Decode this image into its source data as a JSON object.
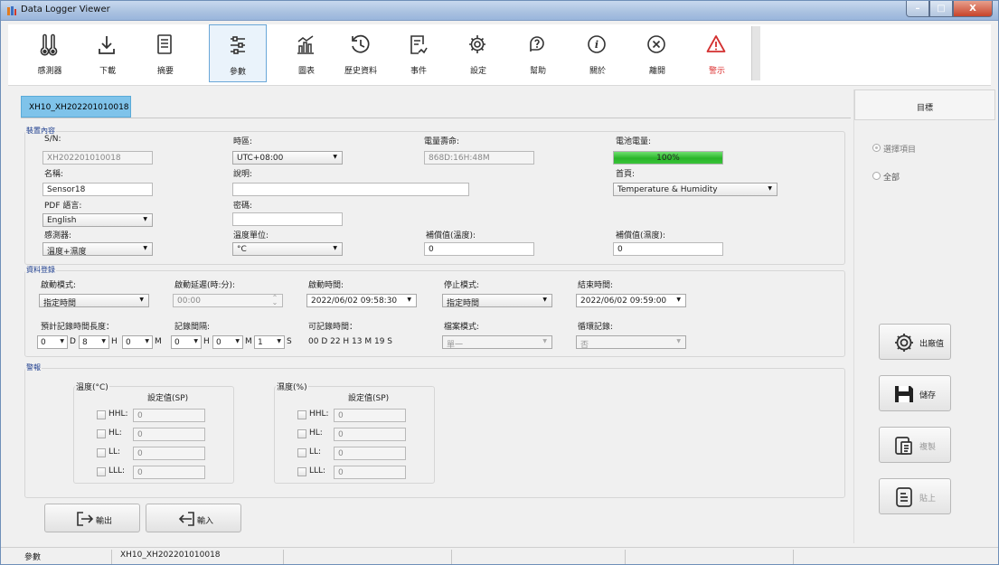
{
  "window": {
    "title": "Data Logger Viewer",
    "controls": {
      "minimize": "–",
      "maximize": "□",
      "close": "X"
    }
  },
  "toolbar": {
    "items": [
      {
        "label": "感測器",
        "icon": "thermometers-icon"
      },
      {
        "label": "下載",
        "icon": "download-icon"
      },
      {
        "label": "摘要",
        "icon": "summary-icon"
      },
      {
        "label": "參數",
        "icon": "sliders-icon",
        "selected": true
      },
      {
        "label": "圖表",
        "icon": "chart-icon"
      },
      {
        "label": "歷史資料",
        "icon": "history-icon"
      },
      {
        "label": "事件",
        "icon": "event-icon"
      },
      {
        "label": "設定",
        "icon": "gear-icon"
      },
      {
        "label": "幫助",
        "icon": "help-icon"
      },
      {
        "label": "關於",
        "icon": "info-icon"
      },
      {
        "label": "離開",
        "icon": "close-circle-icon"
      },
      {
        "label": "警示",
        "icon": "warning-icon",
        "color": "#d32f2f"
      }
    ]
  },
  "device_tab": {
    "label": "XH10_XH202201010018"
  },
  "device_info": {
    "group_title": "裝置內容",
    "sn_label": "S/N:",
    "sn_value": "XH202201010018",
    "timezone_label": "時區:",
    "timezone_value": "UTC+08:00",
    "battery_life_label": "電量壽命:",
    "battery_life_value": "868D:16H:48M",
    "battery_level_label": "電池電量:",
    "battery_level_value": "100%",
    "battery_level_fraction": 1.0,
    "name_label": "名稱:",
    "name_value": "Sensor18",
    "description_label": "說明:",
    "description_value": "",
    "home_label": "首頁:",
    "home_value": "Temperature & Humidity",
    "pdf_lang_label": "PDF 語言:",
    "pdf_lang_value": "English",
    "password_label": "密碼:",
    "password_value": "",
    "sensor_label": "感測器:",
    "sensor_value": "溫度+濕度",
    "temp_unit_label": "溫度單位:",
    "temp_unit_value": "°C",
    "comp_temp_label": "補償值(溫度):",
    "comp_temp_value": "0",
    "comp_hum_label": "補償值(濕度):",
    "comp_hum_value": "0"
  },
  "logging": {
    "group_title": "資料登錄",
    "start_mode_label": "啟動模式:",
    "start_mode_value": "指定時間",
    "start_delay_label": "啟動延遲(時:分):",
    "start_delay_value": "00:00",
    "start_time_label": "啟動時間:",
    "start_time_value": "2022/06/02 09:58:30",
    "stop_mode_label": "停止模式:",
    "stop_mode_value": "指定時間",
    "end_time_label": "結束時間:",
    "end_time_value": "2022/06/02 09:59:00",
    "est_duration_label": "預計記錄時間長度：",
    "interval_label": "記錄間隔:",
    "recordable_label": "可記錄時間：",
    "recordable_value": "00 D 22 H 13 M 19 S",
    "file_mode_label": "檔案模式:",
    "file_mode_value": "單一",
    "cycle_label": "循環記錄:",
    "cycle_value": "否",
    "duration_fields": [
      {
        "value": "0",
        "unit": "D"
      },
      {
        "value": "8",
        "unit": "H"
      },
      {
        "value": "0",
        "unit": "M"
      }
    ],
    "interval_fields": [
      {
        "value": "0",
        "unit": "H"
      },
      {
        "value": "0",
        "unit": "M"
      },
      {
        "value": "1",
        "unit": "S"
      }
    ]
  },
  "alarm": {
    "group_title": "警報",
    "temp_title": "溫度(°C)",
    "hum_title": "濕度(%)",
    "sp_header": "設定值(SP)",
    "temp_rows": [
      {
        "label": "HHL:",
        "value": "0"
      },
      {
        "label": "HL:",
        "value": "0"
      },
      {
        "label": "LL:",
        "value": "0"
      },
      {
        "label": "LLL:",
        "value": "0"
      }
    ],
    "hum_rows": [
      {
        "label": "HHL:",
        "value": "0"
      },
      {
        "label": "HL:",
        "value": "0"
      },
      {
        "label": "LL:",
        "value": "0"
      },
      {
        "label": "LLL:",
        "value": "0"
      }
    ]
  },
  "bottom_buttons": {
    "export_label": "輸出",
    "import_label": "輸入"
  },
  "right_panel": {
    "header": "目標",
    "radio_selected_label": "選擇項目",
    "radio_all_label": "全部",
    "factory_label": "出廠值",
    "save_label": "儲存",
    "copy_label": "複製",
    "paste_label": "貼上"
  },
  "statusbar": {
    "section": "參數",
    "device": "XH10_XH202201010018"
  }
}
